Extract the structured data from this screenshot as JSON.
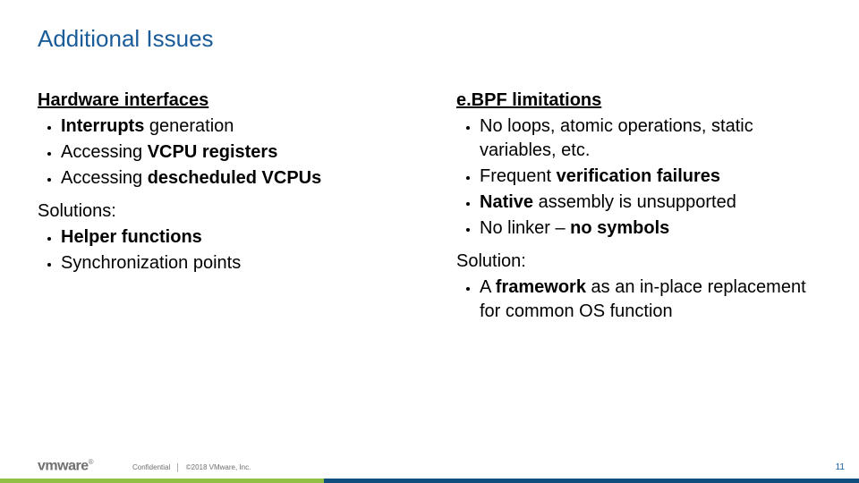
{
  "title": "Additional Issues",
  "left": {
    "h1": "Hardware interfaces",
    "b1_pre": "",
    "b1_bold": "Interrupts",
    "b1_post": " generation",
    "b2_pre": "Accessing ",
    "b2_bold": "VCPU registers",
    "b2_post": "",
    "b3_pre": "Accessing ",
    "b3_bold": "descheduled VCPUs",
    "b3_post": "",
    "h2": "Solutions:",
    "s1_bold": "Helper functions",
    "s2": "Synchronization points"
  },
  "right": {
    "h1": "e.BPF limitations",
    "b1": "No loops, atomic operations, static variables, etc.",
    "b2_pre": "Frequent ",
    "b2_bold": "verification failures",
    "b2_post": "",
    "b3_pre": "",
    "b3_bold": "Native",
    "b3_post": " assembly is unsupported",
    "b4_pre": "No linker – ",
    "b4_bold": "no symbols",
    "b4_post": "",
    "h2": "Solution:",
    "s1_pre": "A ",
    "s1_bold": "framework",
    "s1_post": " as an in-place replacement for common OS function"
  },
  "footer": {
    "logo": "vmware",
    "reg": "®",
    "confidential": "Confidential",
    "sep": "│",
    "copyright": "©2018 VMware, Inc.",
    "page": "11"
  }
}
